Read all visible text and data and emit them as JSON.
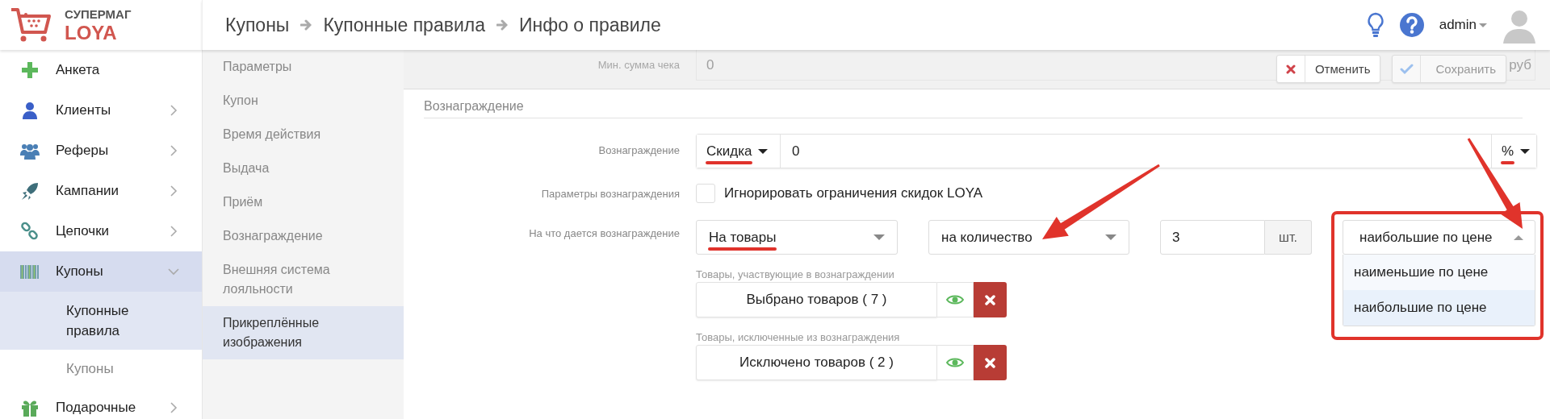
{
  "logo": {
    "line1": "СУПЕРМАГ",
    "line2": "LOYA"
  },
  "breadcrumbs": [
    "Купоны",
    "Купонные правила",
    "Инфо о правиле"
  ],
  "user": {
    "name": "admin"
  },
  "sidebar": {
    "items": [
      {
        "label": "Анкета",
        "kind": "link",
        "selected": false
      },
      {
        "label": "Клиенты",
        "kind": "group",
        "expanded": false,
        "selected": false
      },
      {
        "label": "Реферы",
        "kind": "group",
        "expanded": false,
        "selected": false
      },
      {
        "label": "Кампании",
        "kind": "group",
        "expanded": false,
        "selected": false
      },
      {
        "label": "Цепочки",
        "kind": "group",
        "expanded": false,
        "selected": false
      },
      {
        "label": "Купоны",
        "kind": "group",
        "expanded": true,
        "selected": true,
        "children": [
          {
            "label": "Купонные правила",
            "selected": true
          },
          {
            "label": "Купоны",
            "selected": false
          }
        ]
      },
      {
        "label": "Подарочные",
        "kind": "group",
        "expanded": false,
        "selected": false
      }
    ]
  },
  "sections": [
    {
      "label": "Параметры",
      "selected": false
    },
    {
      "label": "Купон",
      "selected": false
    },
    {
      "label": "Время действия",
      "selected": false
    },
    {
      "label": "Выдача",
      "selected": false
    },
    {
      "label": "Приём",
      "selected": false
    },
    {
      "label": "Вознаграждение",
      "selected": false
    },
    {
      "label": "Внешняя система лояльности",
      "selected": false
    },
    {
      "label": "Прикреплённые изображения",
      "selected": true
    }
  ],
  "faded_row": {
    "label": "Мин. сумма чека",
    "value": "0",
    "unit": "руб"
  },
  "actions": [
    {
      "label": "Отменить",
      "kind": "cancel",
      "disabled": false
    },
    {
      "label": "Сохранить",
      "kind": "save",
      "disabled": true
    }
  ],
  "section_title": "Вознаграждение",
  "reward_row": {
    "label": "Вознаграждение",
    "type": {
      "value": "Скидка",
      "underlined": true
    },
    "value": "0",
    "unit": {
      "value": "%",
      "underlined": true
    }
  },
  "params_row": {
    "label": "Параметры вознаграждения",
    "checkbox": {
      "label": "Игнорировать ограничения скидок LOYA",
      "checked": false
    }
  },
  "target_row": {
    "label": "На что дается вознаграждение",
    "target": {
      "value": "На товары",
      "underlined": true
    },
    "basis": {
      "value": "на количество",
      "pointed": true
    },
    "quantity": "3",
    "quantity_unit": "шт.",
    "order": {
      "value": "наибольшие по цене",
      "expanded": true,
      "pointed": true,
      "framed": true,
      "options": [
        {
          "label": "наименьшие по цене",
          "selected": false
        },
        {
          "label": "наибольшие по цене",
          "selected": true
        }
      ]
    }
  },
  "product_groups": [
    {
      "caption": "Товары, участвующие в вознаграждении",
      "button": "Выбрано товаров ( 7 )"
    },
    {
      "caption": "Товары, исключенные из вознаграждения",
      "button": "Исключено товаров ( 2 )"
    }
  ]
}
